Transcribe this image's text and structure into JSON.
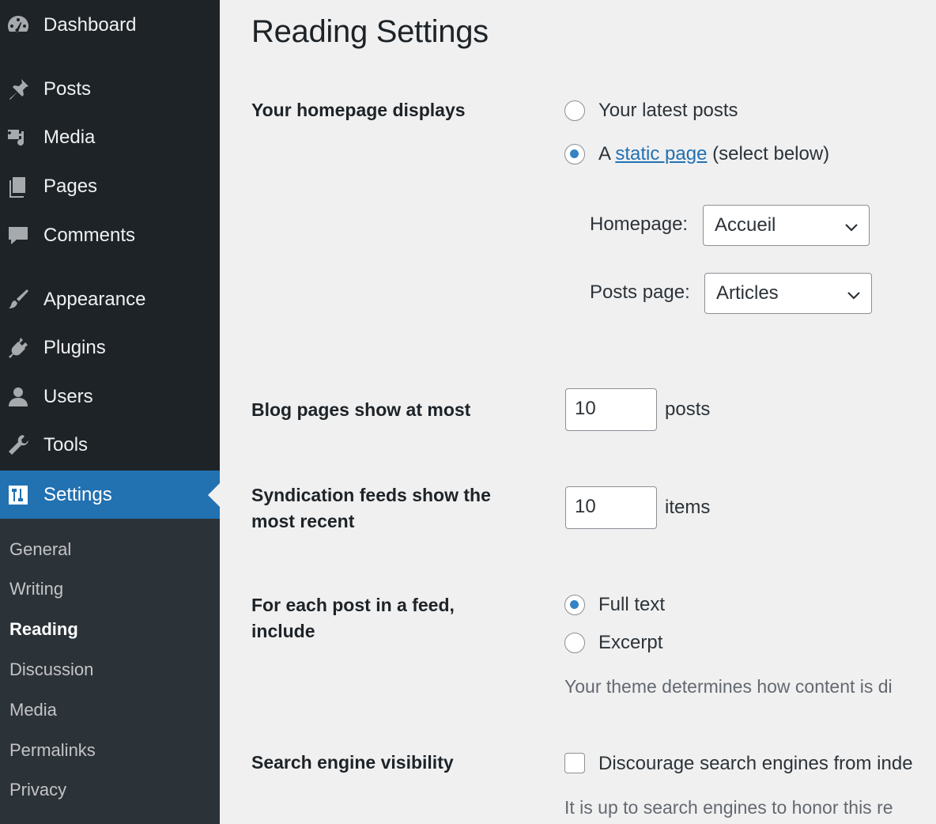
{
  "sidebar": {
    "items": [
      {
        "label": "Dashboard",
        "icon": "dashboard-icon"
      },
      {
        "label": "Posts",
        "icon": "pin-icon"
      },
      {
        "label": "Media",
        "icon": "media-icon"
      },
      {
        "label": "Pages",
        "icon": "pages-icon"
      },
      {
        "label": "Comments",
        "icon": "comment-icon"
      },
      {
        "label": "Appearance",
        "icon": "paintbrush-icon"
      },
      {
        "label": "Plugins",
        "icon": "plugin-icon"
      },
      {
        "label": "Users",
        "icon": "user-icon"
      },
      {
        "label": "Tools",
        "icon": "wrench-icon"
      },
      {
        "label": "Settings",
        "icon": "settings-icon"
      }
    ],
    "submenu": [
      "General",
      "Writing",
      "Reading",
      "Discussion",
      "Media",
      "Permalinks",
      "Privacy"
    ],
    "current_submenu": "Reading"
  },
  "page": {
    "title": "Reading Settings",
    "homepage_displays": {
      "label": "Your homepage displays",
      "option_latest": "Your latest posts",
      "option_static_prefix": "A",
      "option_static_link": "static page",
      "option_static_suffix": "(select below)",
      "selected": "static",
      "homepage_label": "Homepage:",
      "homepage_value": "Accueil",
      "posts_page_label": "Posts page:",
      "posts_page_value": "Articles"
    },
    "blog_pages": {
      "label": "Blog pages show at most",
      "value": "10",
      "unit": "posts"
    },
    "syndication": {
      "label": "Syndication feeds show the most recent",
      "value": "10",
      "unit": "items"
    },
    "feed_content": {
      "label": "For each post in a feed, include",
      "option_full": "Full text",
      "option_excerpt": "Excerpt",
      "selected": "full",
      "description": "Your theme determines how content is di"
    },
    "search_visibility": {
      "label": "Search engine visibility",
      "checkbox_label": "Discourage search engines from inde",
      "checked": false,
      "description": "It is up to search engines to honor this re"
    }
  },
  "colors": {
    "sidebar_bg": "#1d2327",
    "submenu_bg": "#2c3338",
    "accent": "#2271b1",
    "page_bg": "#f0f0f1"
  }
}
